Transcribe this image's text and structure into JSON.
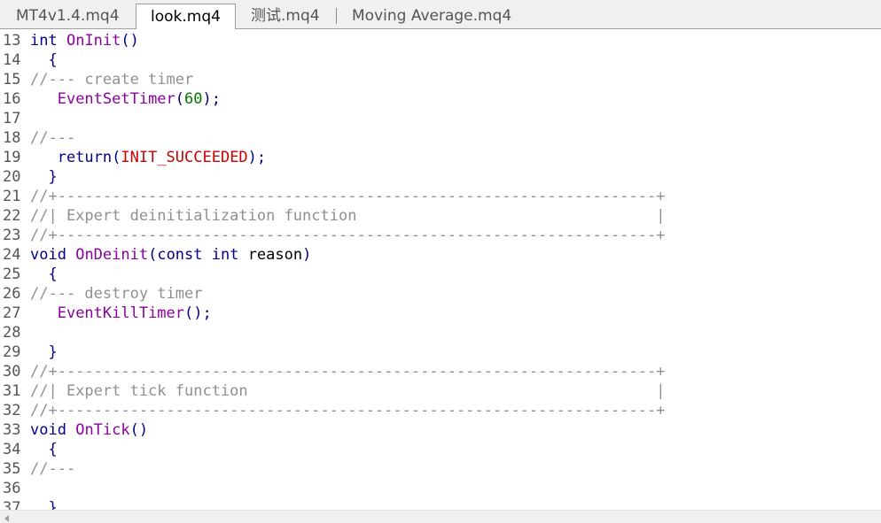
{
  "tabs": [
    {
      "label": "MT4v1.4.mq4",
      "active": false
    },
    {
      "label": "look.mq4",
      "active": true
    },
    {
      "label": "测试.mq4",
      "active": false
    },
    {
      "label": "Moving Average.mq4",
      "active": false
    }
  ],
  "code_lines": [
    {
      "num": "13",
      "tokens": [
        {
          "t": "int",
          "c": "kw"
        },
        {
          "t": " ",
          "c": ""
        },
        {
          "t": "OnInit",
          "c": "fn"
        },
        {
          "t": "()",
          "c": "kw"
        }
      ]
    },
    {
      "num": "14",
      "tokens": [
        {
          "t": "  {",
          "c": "kw"
        }
      ]
    },
    {
      "num": "15",
      "tokens": [
        {
          "t": "//--- create timer",
          "c": "cm"
        }
      ]
    },
    {
      "num": "16",
      "tokens": [
        {
          "t": "   ",
          "c": ""
        },
        {
          "t": "EventSetTimer",
          "c": "fn"
        },
        {
          "t": "(",
          "c": "kw"
        },
        {
          "t": "60",
          "c": "num"
        },
        {
          "t": ");",
          "c": "kw"
        }
      ]
    },
    {
      "num": "17",
      "tokens": []
    },
    {
      "num": "18",
      "tokens": [
        {
          "t": "//---",
          "c": "cm"
        }
      ]
    },
    {
      "num": "19",
      "tokens": [
        {
          "t": "   return",
          "c": "kw"
        },
        {
          "t": "(",
          "c": "kw"
        },
        {
          "t": "INIT_SUCCEEDED",
          "c": "cst"
        },
        {
          "t": ");",
          "c": "kw"
        }
      ]
    },
    {
      "num": "20",
      "tokens": [
        {
          "t": "  }",
          "c": "kw"
        }
      ]
    },
    {
      "num": "21",
      "tokens": [
        {
          "t": "//+------------------------------------------------------------------+",
          "c": "cm"
        }
      ]
    },
    {
      "num": "22",
      "tokens": [
        {
          "t": "//| Expert deinitialization function                                 |",
          "c": "cm"
        }
      ]
    },
    {
      "num": "23",
      "tokens": [
        {
          "t": "//+------------------------------------------------------------------+",
          "c": "cm"
        }
      ]
    },
    {
      "num": "24",
      "tokens": [
        {
          "t": "void",
          "c": "kw"
        },
        {
          "t": " ",
          "c": ""
        },
        {
          "t": "OnDeinit",
          "c": "fn"
        },
        {
          "t": "(const int",
          "c": "kw"
        },
        {
          "t": " reason",
          "c": ""
        },
        {
          "t": ")",
          "c": "kw"
        }
      ]
    },
    {
      "num": "25",
      "tokens": [
        {
          "t": "  {",
          "c": "kw"
        }
      ]
    },
    {
      "num": "26",
      "tokens": [
        {
          "t": "//--- destroy timer",
          "c": "cm"
        }
      ]
    },
    {
      "num": "27",
      "tokens": [
        {
          "t": "   ",
          "c": ""
        },
        {
          "t": "EventKillTimer",
          "c": "fn"
        },
        {
          "t": "();",
          "c": "kw"
        }
      ]
    },
    {
      "num": "28",
      "tokens": []
    },
    {
      "num": "29",
      "tokens": [
        {
          "t": "  }",
          "c": "kw"
        }
      ]
    },
    {
      "num": "30",
      "tokens": [
        {
          "t": "//+------------------------------------------------------------------+",
          "c": "cm"
        }
      ]
    },
    {
      "num": "31",
      "tokens": [
        {
          "t": "//| Expert tick function                                             |",
          "c": "cm"
        }
      ]
    },
    {
      "num": "32",
      "tokens": [
        {
          "t": "//+------------------------------------------------------------------+",
          "c": "cm"
        }
      ]
    },
    {
      "num": "33",
      "tokens": [
        {
          "t": "void",
          "c": "kw"
        },
        {
          "t": " ",
          "c": ""
        },
        {
          "t": "OnTick",
          "c": "fn"
        },
        {
          "t": "()",
          "c": "kw"
        }
      ]
    },
    {
      "num": "34",
      "tokens": [
        {
          "t": "  {",
          "c": "kw"
        }
      ]
    },
    {
      "num": "35",
      "tokens": [
        {
          "t": "//---",
          "c": "cm"
        }
      ]
    },
    {
      "num": "36",
      "tokens": []
    },
    {
      "num": "37",
      "tokens": [
        {
          "t": "  }",
          "c": "kw"
        }
      ]
    }
  ]
}
